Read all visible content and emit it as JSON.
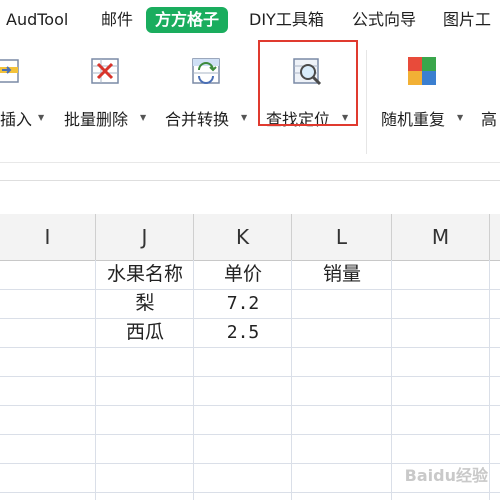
{
  "tabs": [
    {
      "label": "AudTool"
    },
    {
      "label": "邮件"
    },
    {
      "label": "方方格子"
    },
    {
      "label": "DIY工具箱"
    },
    {
      "label": "公式向导"
    },
    {
      "label": "图片工"
    }
  ],
  "active_tab": "方方格子",
  "tools": [
    {
      "label": "插入",
      "icon": "insert-icon"
    },
    {
      "label": "批量删除",
      "icon": "batch-delete-icon"
    },
    {
      "label": "合并转换",
      "icon": "merge-convert-icon"
    },
    {
      "label": "查找定位",
      "icon": "find-locate-icon"
    },
    {
      "label": "随机重复",
      "icon": "random-repeat-icon"
    },
    {
      "label": "高"
    }
  ],
  "highlight_color": "#e03a2f",
  "accent_color": "#1aad5e",
  "columns": [
    "I",
    "J",
    "K",
    "L",
    "M"
  ],
  "table": {
    "rows": [
      {
        "J": "水果名称",
        "K": "单价",
        "L": "销量"
      },
      {
        "J": "梨",
        "K": "7.2",
        "L": ""
      },
      {
        "J": "西瓜",
        "K": "2.5",
        "L": ""
      }
    ]
  },
  "watermark": "Baidu经验"
}
